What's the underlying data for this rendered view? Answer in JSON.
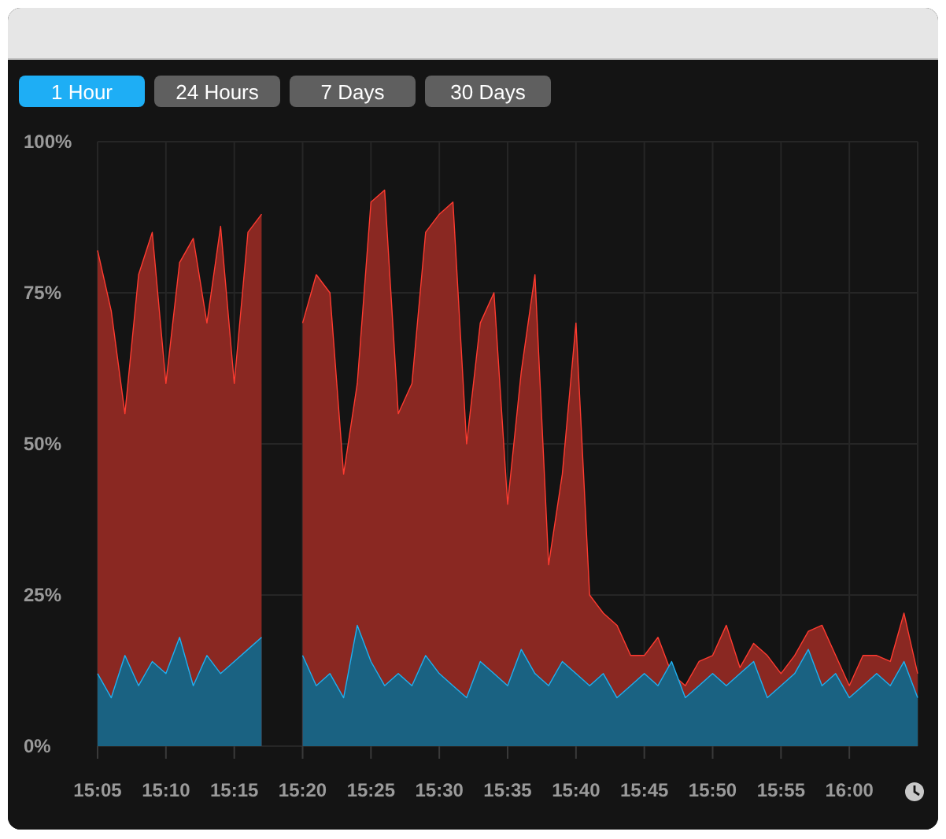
{
  "tabs": [
    {
      "label": "1 Hour",
      "selected": true
    },
    {
      "label": "24 Hours",
      "selected": false
    },
    {
      "label": "7 Days",
      "selected": false
    },
    {
      "label": "30 Days",
      "selected": false
    }
  ],
  "chart_data": {
    "type": "area",
    "stacked": false,
    "grid": true,
    "categories": [
      "15:05",
      null,
      null,
      null,
      null,
      "15:10",
      null,
      null,
      null,
      null,
      "15:15",
      null,
      null,
      null,
      null,
      "15:20",
      null,
      null,
      null,
      null,
      "15:25",
      null,
      null,
      null,
      null,
      "15:30",
      null,
      null,
      null,
      null,
      "15:35",
      null,
      null,
      null,
      null,
      "15:40",
      null,
      null,
      null,
      null,
      "15:45",
      null,
      null,
      null,
      null,
      "15:50",
      null,
      null,
      null,
      null,
      "15:55",
      null,
      null,
      null,
      null,
      "16:00",
      null,
      null,
      null,
      null,
      null
    ],
    "series": [
      {
        "color": "#ff3b30",
        "values": [
          82,
          72,
          55,
          78,
          85,
          60,
          80,
          84,
          70,
          86,
          60,
          85,
          88,
          null,
          null,
          70,
          78,
          75,
          45,
          60,
          90,
          92,
          55,
          60,
          85,
          88,
          90,
          50,
          70,
          75,
          40,
          62,
          78,
          30,
          45,
          70,
          25,
          22,
          20,
          15,
          15,
          18,
          12,
          10,
          14,
          15,
          20,
          13,
          17,
          15,
          12,
          15,
          19,
          20,
          15,
          10,
          15,
          15,
          14,
          22,
          12
        ]
      },
      {
        "color": "#1fb0f0",
        "values": [
          12,
          8,
          15,
          10,
          14,
          12,
          18,
          10,
          15,
          12,
          14,
          16,
          18,
          null,
          null,
          15,
          10,
          12,
          8,
          20,
          14,
          10,
          12,
          10,
          15,
          12,
          10,
          8,
          14,
          12,
          10,
          16,
          12,
          10,
          14,
          12,
          10,
          12,
          8,
          10,
          12,
          10,
          14,
          8,
          10,
          12,
          10,
          12,
          14,
          8,
          10,
          12,
          16,
          10,
          12,
          8,
          10,
          12,
          10,
          14,
          8
        ]
      }
    ],
    "ylim": [
      0,
      100
    ],
    "yticks": [
      {
        "value": 0,
        "label": "0%"
      },
      {
        "value": 25,
        "label": "25%"
      },
      {
        "value": 50,
        "label": "50%"
      },
      {
        "value": 75,
        "label": "75%"
      },
      {
        "value": 100,
        "label": "100%"
      }
    ]
  }
}
